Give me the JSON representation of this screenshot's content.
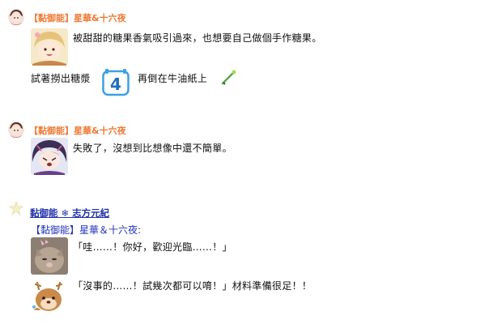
{
  "posts": [
    {
      "nickname": "【黏御能】星華&十六夜",
      "line1": "被甜甜的糖果香氣吸引過來，也想要自己做個手作糖果。",
      "line2_before": "試著撈出糖漿",
      "dice_value": "4",
      "line2_after": "再倒在牛油紙上"
    },
    {
      "nickname": "【黏御能】星華&十六夜",
      "line1": "失敗了，沒想到比想像中還不簡單。"
    }
  ],
  "reply": {
    "author": "黏御能 ❄ 志方元紀",
    "quoted_name": "【黏御能】星華＆十六夜:",
    "line1": "「哇……！你好，歡迎光臨……！」",
    "line2": "「沒事的……！試幾次都可以唷！」材料準備很足！！"
  },
  "colors": {
    "nickname": "#ee7a35",
    "reply_author": "#2233aa",
    "dice": "#3aa0e8"
  }
}
